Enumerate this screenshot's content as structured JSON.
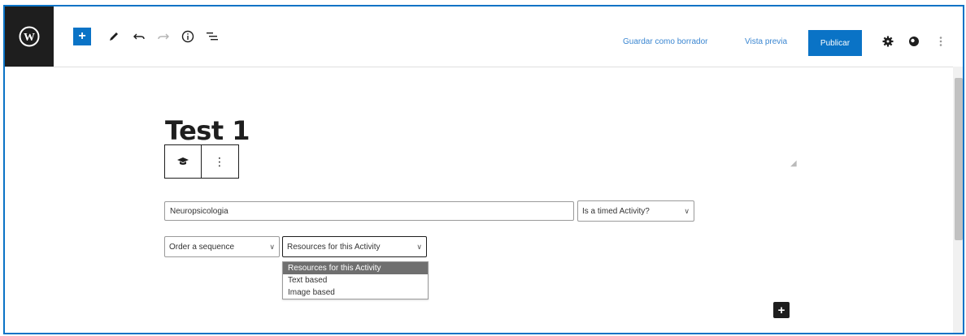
{
  "toolbar": {
    "add_label": "+",
    "save_draft_label": "Guardar como borrador",
    "preview_label": "Vista previa",
    "publish_label": "Publicar",
    "icons": [
      "wordpress-logo-icon",
      "add-block-icon",
      "pencil-tools-icon",
      "undo-icon",
      "redo-icon",
      "info-icon",
      "list-view-icon",
      "settings-gear-icon",
      "plugin-icon",
      "more-options-icon"
    ]
  },
  "editor": {
    "title": "Test 1",
    "block_toolbar": {
      "more_label": "⋮"
    },
    "text_field_value": "Neuropsicologia",
    "timed_select": "Is a timed Activity?",
    "type_select": "Order a sequence",
    "resources_select": "Resources for this Activity",
    "resources_options": [
      "Resources for this Activity",
      "Text based",
      "Image based"
    ],
    "inserter_label": "+"
  },
  "colors": {
    "accent": "#0a73c6",
    "dark": "#1e1e1e",
    "link": "#3a86d1",
    "selected_option_bg": "#6f6f6f"
  }
}
